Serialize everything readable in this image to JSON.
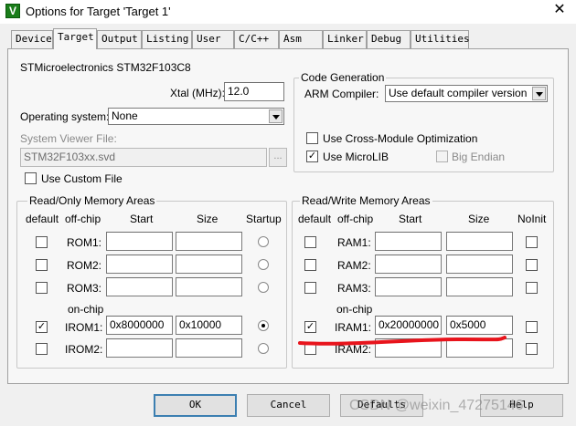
{
  "window": {
    "title": "Options for Target 'Target 1'",
    "close_glyph": "✕",
    "icon": "keil-uvision-icon"
  },
  "tabs": [
    {
      "label": "Device"
    },
    {
      "label": "Target"
    },
    {
      "label": "Output"
    },
    {
      "label": "Listing"
    },
    {
      "label": "User"
    },
    {
      "label": "C/C++"
    },
    {
      "label": "Asm"
    },
    {
      "label": "Linker"
    },
    {
      "label": "Debug"
    },
    {
      "label": "Utilities"
    }
  ],
  "active_tab": "Target",
  "device": {
    "name": "STMicroelectronics STM32F103C8"
  },
  "xtal": {
    "label": "Xtal (MHz):",
    "value": "12.0"
  },
  "os": {
    "label": "Operating system:",
    "value": "None"
  },
  "svd": {
    "label": "System Viewer File:",
    "value": "STM32F103xx.svd",
    "browse": "..."
  },
  "custom_file": {
    "label": "Use Custom File",
    "checked": false
  },
  "codegen": {
    "title": "Code Generation",
    "compiler_label": "ARM Compiler:",
    "compiler_value": "Use default compiler version",
    "cross_module": {
      "label": "Use Cross-Module Optimization",
      "checked": false
    },
    "microlib": {
      "label": "Use MicroLIB",
      "checked": true
    },
    "big_endian": {
      "label": "Big Endian",
      "checked": false
    }
  },
  "rom_areas": {
    "title": "Read/Only Memory Areas",
    "headers": {
      "default": "default",
      "offchip": "off-chip",
      "start": "Start",
      "size": "Size",
      "startup": "Startup"
    },
    "onchip_label": "on-chip",
    "rows": [
      {
        "name": "ROM1:",
        "start": "",
        "size": "",
        "default": false,
        "startup": false
      },
      {
        "name": "ROM2:",
        "start": "",
        "size": "",
        "default": false,
        "startup": false
      },
      {
        "name": "ROM3:",
        "start": "",
        "size": "",
        "default": false,
        "startup": false
      },
      {
        "name": "IROM1:",
        "start": "0x8000000",
        "size": "0x10000",
        "default": true,
        "startup": true
      },
      {
        "name": "IROM2:",
        "start": "",
        "size": "",
        "default": false,
        "startup": false
      }
    ]
  },
  "ram_areas": {
    "title": "Read/Write Memory Areas",
    "headers": {
      "default": "default",
      "offchip": "off-chip",
      "start": "Start",
      "size": "Size",
      "noinit": "NoInit"
    },
    "onchip_label": "on-chip",
    "rows": [
      {
        "name": "RAM1:",
        "start": "",
        "size": "",
        "default": false,
        "noinit": false
      },
      {
        "name": "RAM2:",
        "start": "",
        "size": "",
        "default": false,
        "noinit": false
      },
      {
        "name": "RAM3:",
        "start": "",
        "size": "",
        "default": false,
        "noinit": false
      },
      {
        "name": "IRAM1:",
        "start": "0x20000000",
        "size": "0x5000",
        "default": true,
        "noinit": false
      },
      {
        "name": "IRAM2:",
        "start": "",
        "size": "",
        "default": false,
        "noinit": false
      }
    ]
  },
  "buttons": {
    "ok": "OK",
    "cancel": "Cancel",
    "defaults": "Defaults",
    "help": "Help"
  },
  "watermark": "CSDN @weixin_47275146",
  "colors": {
    "annotation": "#e8141c",
    "default_button_border": "#3c7fb1"
  }
}
